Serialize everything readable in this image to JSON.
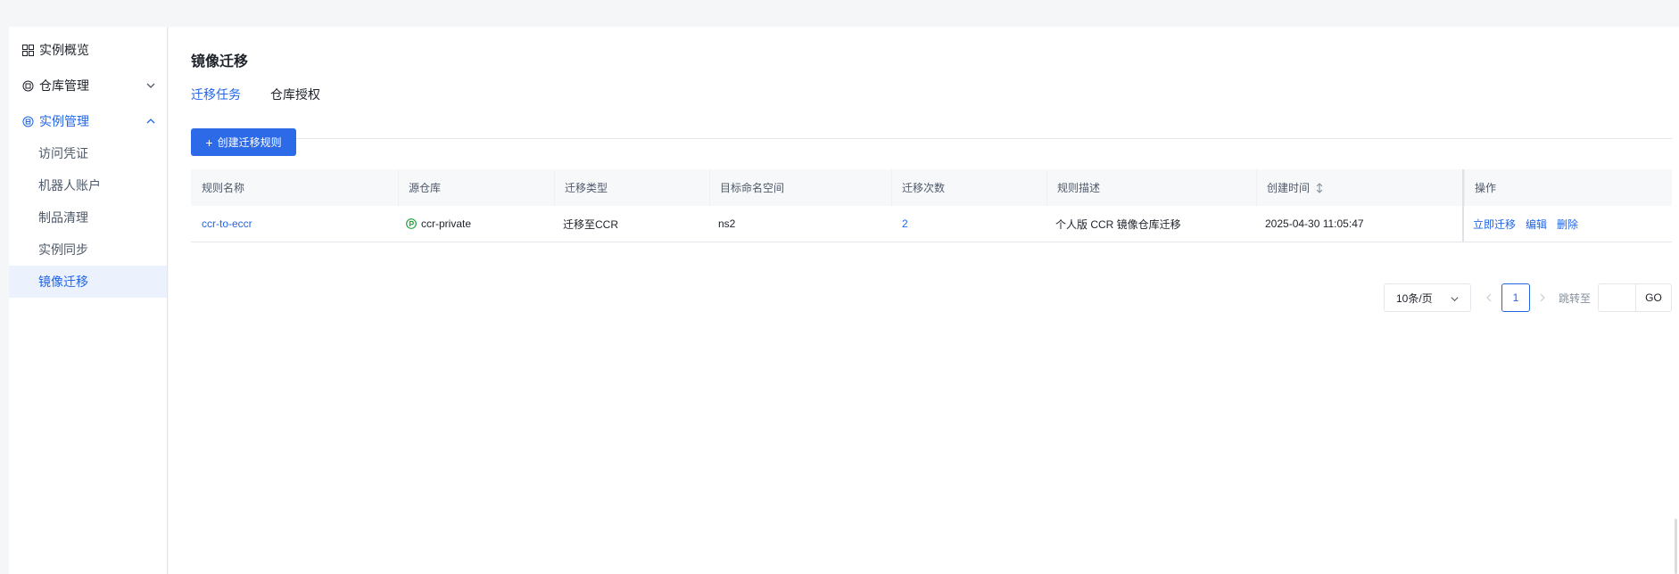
{
  "sidebar": {
    "overview": {
      "label": "实例概览",
      "icon": "grid-icon"
    },
    "repo_mgmt": {
      "label": "仓库管理",
      "icon": "repo-icon"
    },
    "instance_mgmt": {
      "label": "实例管理",
      "icon": "instance-icon"
    },
    "sub_items": [
      {
        "label": "访问凭证"
      },
      {
        "label": "机器人账户"
      },
      {
        "label": "制品清理"
      },
      {
        "label": "实例同步"
      },
      {
        "label": "镜像迁移"
      }
    ],
    "accent_color": "#2165e6"
  },
  "main": {
    "title": "镜像迁移",
    "tabs": [
      {
        "label": "迁移任务",
        "active": true
      },
      {
        "label": "仓库授权",
        "active": false
      }
    ],
    "create_button": "创建迁移规则"
  },
  "table": {
    "headers": [
      "规则名称",
      "源仓库",
      "迁移类型",
      "目标命名空间",
      "迁移次数",
      "规则描述",
      "创建时间",
      "操作"
    ],
    "rows": [
      {
        "name": "ccr-to-eccr",
        "source": "ccr-private",
        "type": "迁移至CCR",
        "namespace": "ns2",
        "count": "2",
        "description": "个人版 CCR 镜像仓库迁移",
        "created": "2025-04-30 11:05:47",
        "ops": [
          "立即迁移",
          "编辑",
          "删除"
        ]
      }
    ]
  },
  "pagination": {
    "page_size": "10条/页",
    "current_page": "1",
    "jump_label": "跳转至",
    "go": "GO"
  }
}
